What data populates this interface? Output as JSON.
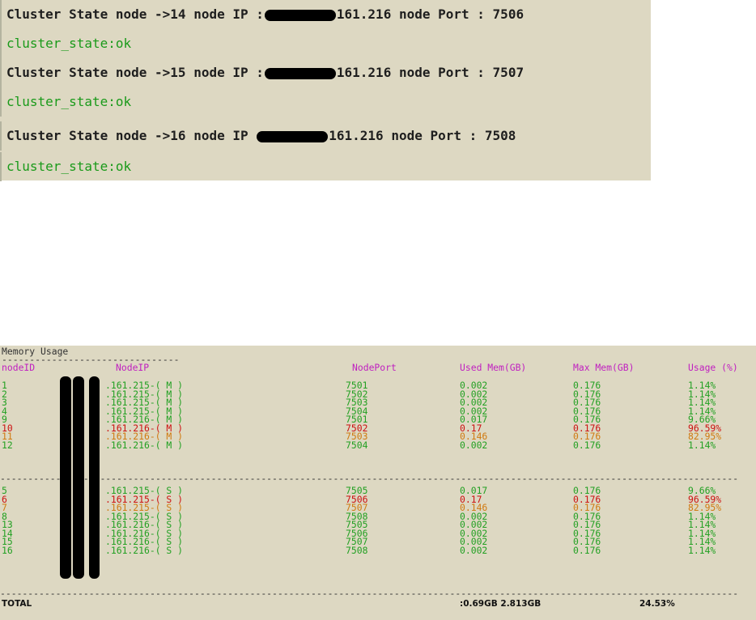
{
  "cluster_state": {
    "lines": [
      {
        "head_a": "Cluster State node ->14 node IP :",
        "head_b": "161.216 node Port : 7506",
        "status": "cluster_state:ok"
      },
      {
        "head_a": "Cluster State node ->15 node IP :",
        "head_b": "161.216 node Port : 7507",
        "status": "cluster_state:ok"
      },
      {
        "head_a": "Cluster State node ->16 node IP ",
        "head_b": "161.216 node Port : 7508",
        "status": "cluster_state:ok"
      }
    ]
  },
  "memory": {
    "title": "Memory Usage",
    "title_rule": "--------------------------------",
    "headers": {
      "node_id": "nodeID",
      "node_ip": "NodeIP",
      "node_port": "NodePort",
      "used_mem": "Used Mem(GB)",
      "max_mem": "Max Mem(GB)",
      "usage": "Usage (%)"
    },
    "masters": [
      {
        "id": "1",
        "ip": ".161.215-( M )",
        "port": "7501",
        "used": "0.002",
        "max": "0.176",
        "pct": "1.14%",
        "level": "ok"
      },
      {
        "id": "2",
        "ip": ".161.215-( M )",
        "port": "7502",
        "used": "0.002",
        "max": "0.176",
        "pct": "1.14%",
        "level": "ok"
      },
      {
        "id": "3",
        "ip": ".161.215-( M )",
        "port": "7503",
        "used": "0.002",
        "max": "0.176",
        "pct": "1.14%",
        "level": "ok"
      },
      {
        "id": "4",
        "ip": ".161.215-( M )",
        "port": "7504",
        "used": "0.002",
        "max": "0.176",
        "pct": "1.14%",
        "level": "ok"
      },
      {
        "id": "9",
        "ip": ".161.216-( M )",
        "port": "7501",
        "used": "0.017",
        "max": "0.176",
        "pct": "9.66%",
        "level": "ok"
      },
      {
        "id": "10",
        "ip": ".161.216-( M )",
        "port": "7502",
        "used": "0.17",
        "max": "0.176",
        "pct": "96.59%",
        "level": "critical"
      },
      {
        "id": "11",
        "ip": ".161.216-( M )",
        "port": "7503",
        "used": "0.146",
        "max": "0.176",
        "pct": "82.95%",
        "level": "warning"
      },
      {
        "id": "12",
        "ip": ".161.216-( M )",
        "port": "7504",
        "used": "0.002",
        "max": "0.176",
        "pct": "1.14%",
        "level": "ok"
      }
    ],
    "slaves": [
      {
        "id": "5",
        "ip": ".161.215-( S )",
        "port": "7505",
        "used": "0.017",
        "max": "0.176",
        "pct": "9.66%",
        "level": "ok"
      },
      {
        "id": "6",
        "ip": ".161.215-( S )",
        "port": "7506",
        "used": "0.17",
        "max": "0.176",
        "pct": "96.59%",
        "level": "critical"
      },
      {
        "id": "7",
        "ip": ".161.215-( S )",
        "port": "7507",
        "used": "0.146",
        "max": "0.176",
        "pct": "82.95%",
        "level": "warning"
      },
      {
        "id": "8",
        "ip": ".161.215-( S )",
        "port": "7508",
        "used": "0.002",
        "max": "0.176",
        "pct": "1.14%",
        "level": "ok"
      },
      {
        "id": "13",
        "ip": ".161.216-( S )",
        "port": "7505",
        "used": "0.002",
        "max": "0.176",
        "pct": "1.14%",
        "level": "ok"
      },
      {
        "id": "14",
        "ip": ".161.216-( S )",
        "port": "7506",
        "used": "0.002",
        "max": "0.176",
        "pct": "1.14%",
        "level": "ok"
      },
      {
        "id": "15",
        "ip": ".161.216-( S )",
        "port": "7507",
        "used": "0.002",
        "max": "0.176",
        "pct": "1.14%",
        "level": "ok"
      },
      {
        "id": "16",
        "ip": ".161.216-( S )",
        "port": "7508",
        "used": "0.002",
        "max": "0.176",
        "pct": "1.14%",
        "level": "ok"
      }
    ],
    "total": {
      "label": "TOTAL",
      "mem": ":0.69GB 2.813GB",
      "pct": "24.53%"
    }
  },
  "colors": {
    "ok": "#22a022",
    "critical": "#cc1111",
    "warning": "#d07a10",
    "header": "#c020c0",
    "panel_bg": "#ddd8c2"
  }
}
